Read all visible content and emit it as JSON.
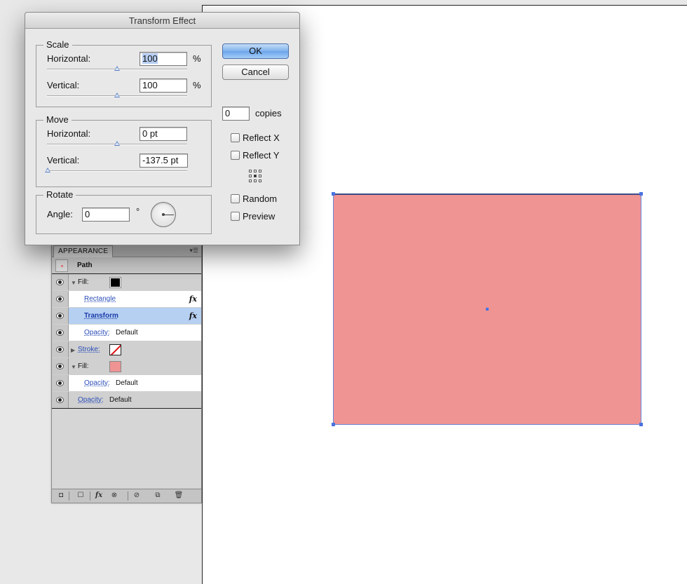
{
  "dialog": {
    "title": "Transform Effect",
    "scale": {
      "legend": "Scale",
      "horizontal_label": "Horizontal:",
      "horizontal_value": "100",
      "horizontal_unit": "%",
      "vertical_label": "Vertical:",
      "vertical_value": "100",
      "vertical_unit": "%"
    },
    "move": {
      "legend": "Move",
      "horizontal_label": "Horizontal:",
      "horizontal_value": "0 pt",
      "vertical_label": "Vertical:",
      "vertical_value": "-137.5 pt"
    },
    "rotate": {
      "legend": "Rotate",
      "angle_label": "Angle:",
      "angle_value": "0",
      "angle_unit": "°"
    },
    "ok_label": "OK",
    "cancel_label": "Cancel",
    "copies_value": "0",
    "copies_label": "copies",
    "reflect_x_label": "Reflect X",
    "reflect_y_label": "Reflect Y",
    "random_label": "Random",
    "preview_label": "Preview"
  },
  "appearance": {
    "tab_label": "APPEARANCE",
    "header_label": "Path",
    "rows": [
      {
        "label": "Fill:"
      },
      {
        "label": "Rectangle"
      },
      {
        "label": "Transform"
      },
      {
        "label": "Opacity:",
        "value": "Default"
      },
      {
        "label": "Stroke:"
      },
      {
        "label": "Fill:"
      },
      {
        "label": "Opacity:",
        "value": "Default"
      },
      {
        "label": "Opacity:",
        "value": "Default"
      }
    ],
    "fx_symbol": "fx"
  },
  "colors": {
    "shape_fill": "#ef9393",
    "selection": "#4a73e0",
    "primary_button": "#7fb2ee"
  }
}
